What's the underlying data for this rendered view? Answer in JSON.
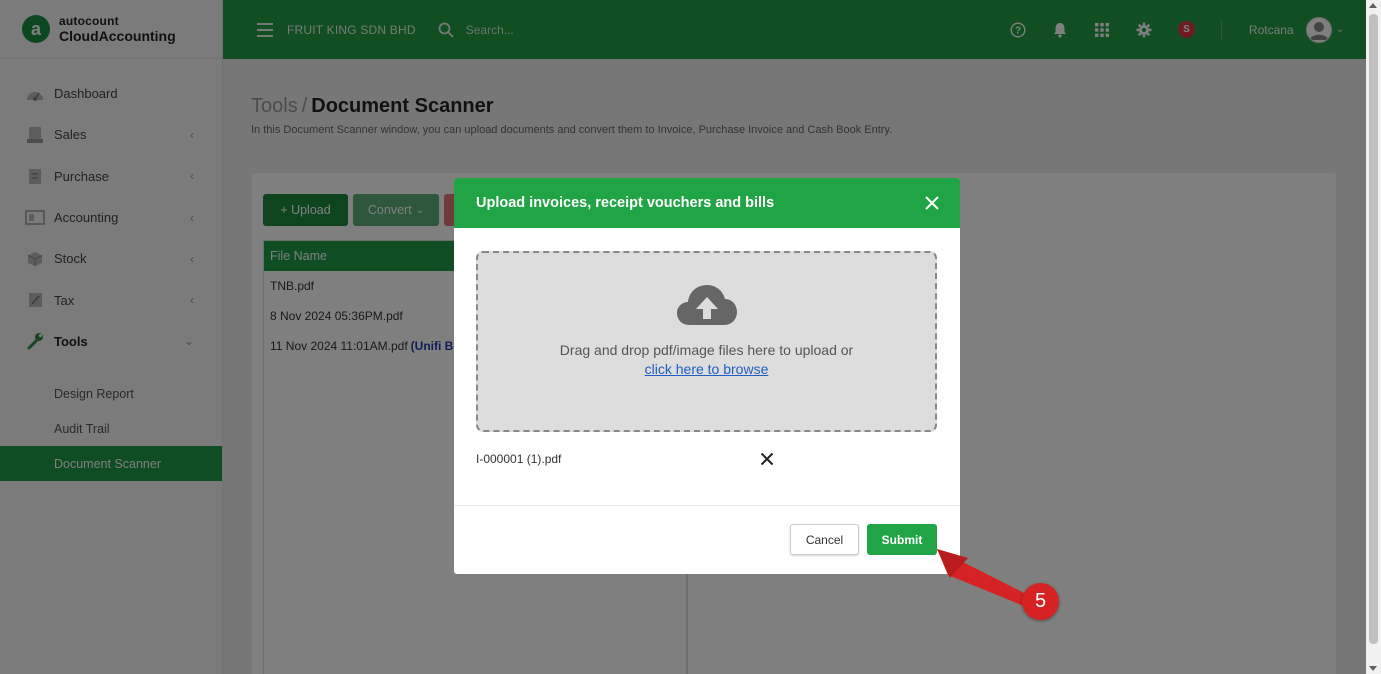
{
  "app": {
    "brand": "autocount",
    "product": "CloudAccounting",
    "logo_letter": "a"
  },
  "header": {
    "company": "FRUIT KING SDN BHD",
    "search_placeholder": "Search...",
    "notification_badge": "S",
    "username": "Rotcana"
  },
  "sidebar": {
    "items": [
      {
        "label": "Dashboard",
        "icon": "dashboard-icon"
      },
      {
        "label": "Sales",
        "icon": "sales-icon"
      },
      {
        "label": "Purchase",
        "icon": "purchase-icon"
      },
      {
        "label": "Accounting",
        "icon": "accounting-icon"
      },
      {
        "label": "Stock",
        "icon": "stock-icon"
      },
      {
        "label": "Tax",
        "icon": "tax-icon"
      },
      {
        "label": "Tools",
        "icon": "wrench-icon"
      }
    ],
    "tools_sub": [
      {
        "label": "Design Report"
      },
      {
        "label": "Audit Trail"
      },
      {
        "label": "Document Scanner"
      }
    ]
  },
  "page": {
    "breadcrumb_parent": "Tools",
    "breadcrumb_sep": "/",
    "title": "Document Scanner",
    "description": "In this Document Scanner window, you can upload documents and convert them to Invoice, Purchase Invoice and Cash Book Entry."
  },
  "toolbar": {
    "upload_label": "+ Upload",
    "convert_label": "Convert"
  },
  "table": {
    "header": "File Name",
    "rows": [
      {
        "name": "TNB.pdf",
        "tag": ""
      },
      {
        "name": "8 Nov 2024 05:36PM.pdf",
        "tag": ""
      },
      {
        "name": "11 Nov 2024 11:01AM.pdf",
        "tag": "(Unifi Bil"
      }
    ]
  },
  "modal": {
    "title": "Upload invoices, receipt vouchers and bills",
    "drop_text": "Drag and drop pdf/image files here to upload or",
    "browse_link": "click here to browse",
    "file_name": "I-000001 (1).pdf",
    "cancel_label": "Cancel",
    "submit_label": "Submit"
  },
  "annotation": {
    "step": "5",
    "color": "#d62222"
  },
  "colors": {
    "primary": "#239c45",
    "sidebar_active": "#1f9a46",
    "badge": "#d9363e",
    "link": "#1f5ec4"
  }
}
